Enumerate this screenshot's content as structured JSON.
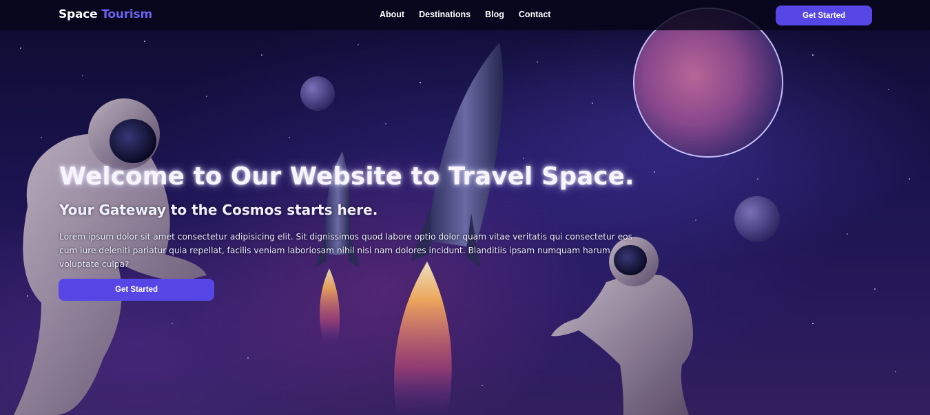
{
  "nav": {
    "brand_part1": "Space",
    "brand_part2": "Tourism",
    "links": [
      "About",
      "Destinations",
      "Blog",
      "Contact"
    ],
    "cta_label": "Get Started"
  },
  "hero": {
    "title": "Welcome to Our Website to Travel Space.",
    "subtitle": "Your Gateway to the Cosmos starts here.",
    "body": "Lorem ipsum dolor sit amet consectetur adipisicing elit. Sit dignissimos quod labore optio dolor quam vitae veritatis qui consectetur eos cum iure deleniti pariatur quia repellat, facilis veniam laboriosam nihil nisi nam dolores incidunt. Blanditiis ipsam numquam harum voluptate culpa?",
    "cta_label": "Get Started"
  },
  "theme": {
    "accent": "#5746e6",
    "brand_accent": "#6d62f0",
    "nav_background": "#06051a"
  },
  "background": {
    "icons": [
      "astronaut-left",
      "astronaut-right",
      "rocket-large",
      "rocket-small",
      "planet-large",
      "planet-small",
      "planet-medium"
    ]
  }
}
